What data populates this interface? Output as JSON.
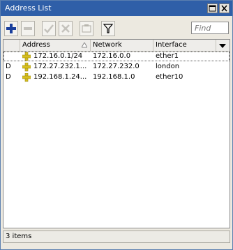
{
  "window": {
    "title": "Address List"
  },
  "toolbar": {
    "find_placeholder": "Find"
  },
  "table": {
    "columns": [
      "",
      "Address",
      "Network",
      "Interface"
    ],
    "rows": [
      {
        "flag": "",
        "address": "172.16.0.1/24",
        "network": "172.16.0.0",
        "interface": "ether1"
      },
      {
        "flag": "D",
        "address": "172.27.232.1...",
        "network": "172.27.232.0",
        "interface": "london"
      },
      {
        "flag": "D",
        "address": "192.168.1.24...",
        "network": "192.168.1.0",
        "interface": "ether10"
      }
    ]
  },
  "status": {
    "text": "3 items"
  },
  "colors": {
    "title_bar": "#2f5fa8",
    "add_icon": "#1a3f9c",
    "address_icon": "#d8c020"
  }
}
